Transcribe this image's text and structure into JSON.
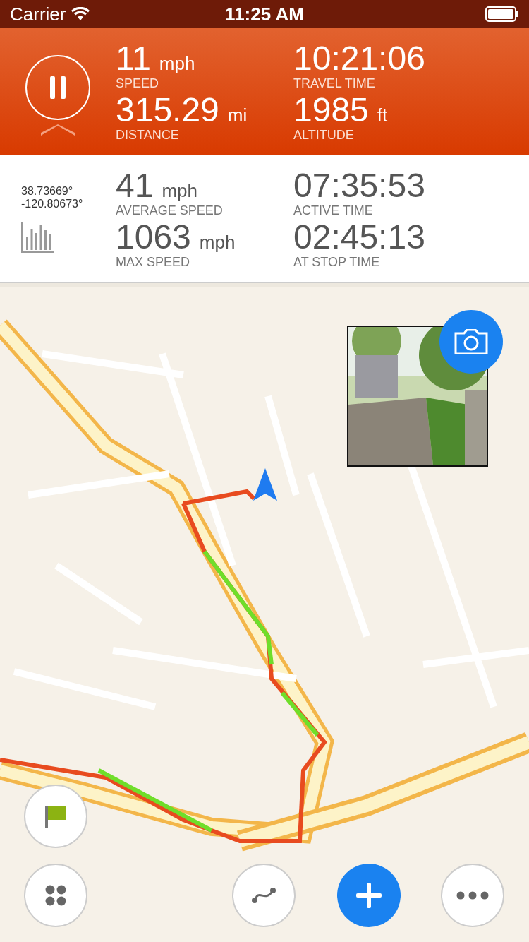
{
  "status_bar": {
    "carrier": "Carrier",
    "time": "11:25 AM"
  },
  "live_stats": [
    {
      "value": "11",
      "unit": "mph",
      "label": "SPEED"
    },
    {
      "value": "10:21:06",
      "label": "TRAVEL TIME"
    },
    {
      "value": "315.29",
      "unit": "mi",
      "label": "DISTANCE"
    },
    {
      "value": "1985",
      "unit": "ft",
      "label": "ALTITUDE"
    }
  ],
  "paused": false,
  "coordinates": [
    "38.73669°",
    "-120.80673°"
  ],
  "summary_stats": [
    {
      "value": "41",
      "unit": "mph",
      "label": "AVERAGE SPEED"
    },
    {
      "value": "07:35:53",
      "label": "ACTIVE TIME"
    },
    {
      "value": "1063",
      "unit": "mph",
      "label": "MAX SPEED"
    },
    {
      "value": "02:45:13",
      "label": "AT STOP TIME"
    }
  ],
  "map": {
    "kind": "picture"
  },
  "photo": {
    "kind": "picture"
  }
}
